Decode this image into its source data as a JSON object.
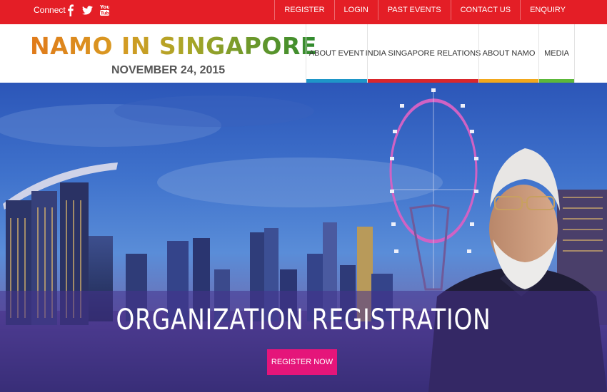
{
  "topbar": {
    "connect_label": "Connect",
    "social": [
      "facebook-icon",
      "twitter-icon",
      "youtube-icon"
    ],
    "links": [
      "REGISTER",
      "LOGIN",
      "PAST EVENTS",
      "CONTACT US",
      "ENQUIRY"
    ],
    "bg_color": "#e41e26"
  },
  "header": {
    "title": "NAMO IN SINGAPORE",
    "date": "NOVEMBER 24, 2015",
    "nav": [
      {
        "label": "ABOUT EVENT",
        "color": "#1e96c8"
      },
      {
        "label": "INDIA SINGAPORE RELATIONS",
        "color": "#d9262c"
      },
      {
        "label": "ABOUT NAMO",
        "color": "#f2a81d"
      },
      {
        "label": "MEDIA",
        "color": "#5cb83a"
      }
    ]
  },
  "hero": {
    "title": "ORGANIZATION REGISTRATION",
    "button_label": "REGISTER NOW",
    "button_color": "#e5157a"
  }
}
